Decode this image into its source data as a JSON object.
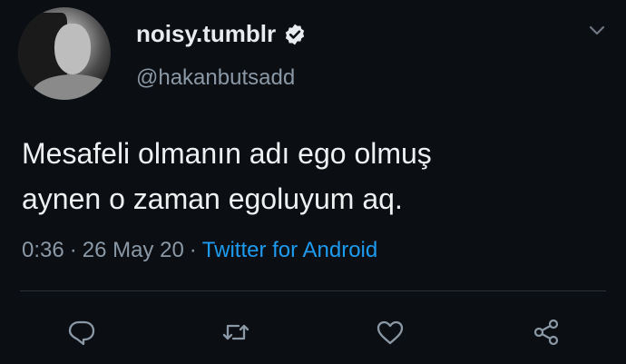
{
  "tweet": {
    "display_name": "noisy.tumblr",
    "verified": true,
    "handle": "@hakanbutsadd",
    "text_lines": [
      "Mesafeli olmanın adı ego olmuş",
      "aynen o zaman egoluyum aq."
    ],
    "time": "0:36",
    "separator": "·",
    "date": "26 May 20",
    "source": "Twitter for Android"
  },
  "icons": {
    "chevron": "chevron-down-icon",
    "reply": "reply-icon",
    "retweet": "retweet-icon",
    "like": "heart-icon",
    "share": "share-icon",
    "verified": "verified-badge-icon"
  },
  "colors": {
    "background": "#0b0e13",
    "text": "#eef0f2",
    "secondary": "#8b98a5",
    "link": "#1d9bf0"
  }
}
